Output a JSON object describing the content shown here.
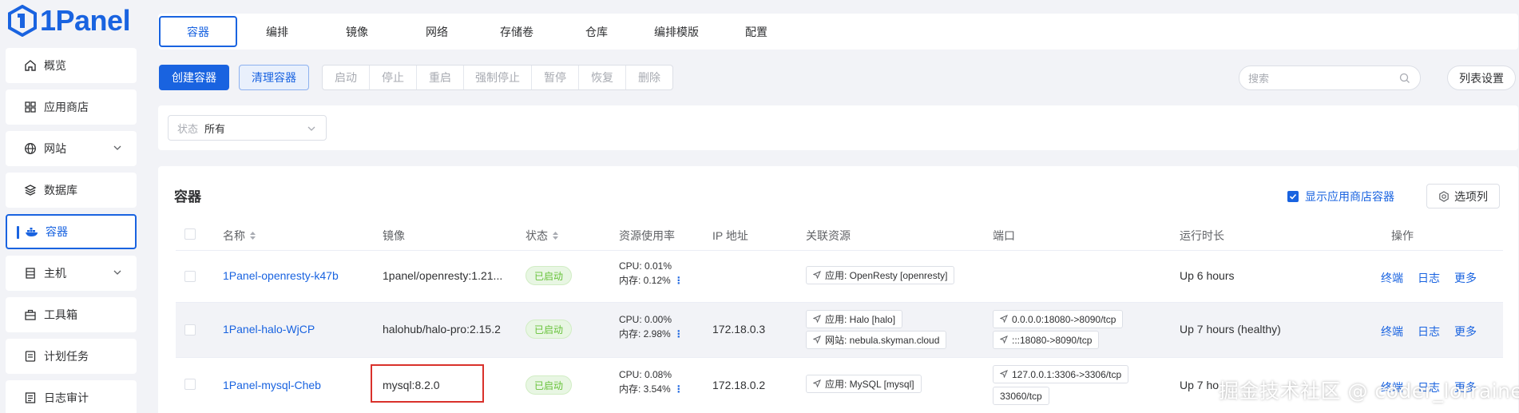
{
  "app": {
    "name": "1Panel"
  },
  "sidebar": {
    "items": [
      {
        "label": "概览",
        "icon": "home-icon"
      },
      {
        "label": "应用商店",
        "icon": "grid-icon"
      },
      {
        "label": "网站",
        "icon": "globe-icon",
        "expandable": true
      },
      {
        "label": "数据库",
        "icon": "layers-icon"
      },
      {
        "label": "容器",
        "icon": "docker-icon",
        "active": true
      },
      {
        "label": "主机",
        "icon": "server-icon",
        "expandable": true
      },
      {
        "label": "工具箱",
        "icon": "toolbox-icon"
      },
      {
        "label": "计划任务",
        "icon": "task-icon"
      },
      {
        "label": "日志审计",
        "icon": "log-icon"
      }
    ]
  },
  "tabs": [
    "容器",
    "编排",
    "镜像",
    "网络",
    "存储卷",
    "仓库",
    "编排模版",
    "配置"
  ],
  "toolbar": {
    "create": "创建容器",
    "clean": "清理容器",
    "group": [
      "启动",
      "停止",
      "重启",
      "强制停止",
      "暂停",
      "恢复",
      "删除"
    ],
    "search_placeholder": "搜索",
    "list_settings": "列表设置"
  },
  "filter": {
    "prefix": "状态",
    "value": "所有"
  },
  "table": {
    "title": "容器",
    "show_store": "显示应用商店容器",
    "columns_button": "选项列",
    "headers": {
      "name": "名称",
      "image": "镜像",
      "status": "状态",
      "usage": "资源使用率",
      "ip": "IP 地址",
      "related": "关联资源",
      "ports": "端口",
      "uptime": "运行时长",
      "actions": "操作"
    },
    "rows": [
      {
        "name": "1Panel-openresty-k47b",
        "image": "1panel/openresty:1.21...",
        "status": "已启动",
        "cpu": "CPU: 0.01%",
        "mem": "内存: 0.12%",
        "ip": "",
        "related": [
          "应用: OpenResty [openresty]"
        ],
        "ports": [],
        "uptime": "Up 6 hours",
        "actions": [
          "终端",
          "日志",
          "更多"
        ]
      },
      {
        "name": "1Panel-halo-WjCP",
        "image": "halohub/halo-pro:2.15.2",
        "status": "已启动",
        "cpu": "CPU: 0.00%",
        "mem": "内存: 2.98%",
        "ip": "172.18.0.3",
        "related": [
          "应用: Halo [halo]",
          "网站: nebula.skyman.cloud"
        ],
        "ports": [
          "0.0.0.0:18080->8090/tcp",
          ":::18080->8090/tcp"
        ],
        "uptime": "Up 7 hours (healthy)",
        "actions": [
          "终端",
          "日志",
          "更多"
        ]
      },
      {
        "name": "1Panel-mysql-Cheb",
        "image": "mysql:8.2.0",
        "status": "已启动",
        "cpu": "CPU: 0.08%",
        "mem": "内存: 3.54%",
        "ip": "172.18.0.2",
        "related": [
          "应用: MySQL [mysql]"
        ],
        "ports": [
          "127.0.0.1:3306->3306/tcp",
          "33060/tcp"
        ],
        "uptime": "Up 7 ho",
        "actions": [
          "终端",
          "日志",
          "更多"
        ]
      }
    ]
  },
  "watermark": "掘金技术社区 @ coder_lorraine",
  "colors": {
    "primary": "#1963e0",
    "success": "#67c23a",
    "highlight": "#d9312b"
  }
}
